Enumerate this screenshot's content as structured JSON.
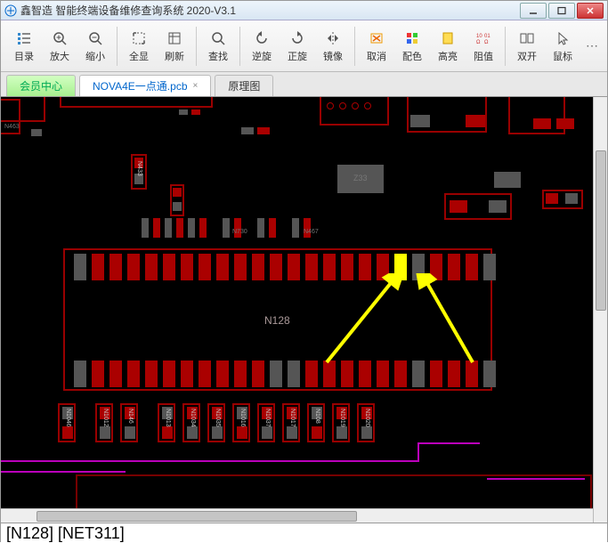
{
  "window": {
    "title": "鑫智造 智能终端设备维修查询系统 2020-V3.1"
  },
  "toolbar": {
    "items": [
      {
        "id": "catalog",
        "label": "目录",
        "glyph": "list"
      },
      {
        "id": "zoomin",
        "label": "放大",
        "glyph": "zoom-in"
      },
      {
        "id": "zoomout",
        "label": "缩小",
        "glyph": "zoom-out"
      },
      {
        "id": "fit",
        "label": "全显",
        "glyph": "fit"
      },
      {
        "id": "refresh",
        "label": "刷新",
        "glyph": "refresh"
      },
      {
        "id": "find",
        "label": "查找",
        "glyph": "search"
      },
      {
        "id": "rotccw",
        "label": "逆旋",
        "glyph": "ccw"
      },
      {
        "id": "rotcw",
        "label": "正旋",
        "glyph": "cw"
      },
      {
        "id": "mirror",
        "label": "镜像",
        "glyph": "mirror"
      },
      {
        "id": "cancel",
        "label": "取消",
        "glyph": "cancel"
      },
      {
        "id": "palette",
        "label": "配色",
        "glyph": "palette"
      },
      {
        "id": "highlight",
        "label": "高亮",
        "glyph": "highlight"
      },
      {
        "id": "imped",
        "label": "阻值",
        "glyph": "ohm"
      },
      {
        "id": "dual",
        "label": "双开",
        "glyph": "dual"
      },
      {
        "id": "mouse",
        "label": "鼠标",
        "glyph": "cursor"
      }
    ]
  },
  "tabs": {
    "member": "会员中心",
    "active": "NOVA4E一点通.pcb",
    "other": "原理图"
  },
  "pcb": {
    "chip_ref": "N128",
    "silklabel": "Z33",
    "top_refs": [
      "N463"
    ],
    "mid_refs": [
      "N433",
      "N730",
      "N467"
    ],
    "bottom_refs": [
      "N1046",
      "N1012",
      "N146",
      "N1013",
      "N1034",
      "N1035",
      "N1016",
      "N1037",
      "N1017",
      "N108",
      "N1019",
      "N1020"
    ]
  },
  "status": {
    "text": "[N128] [NET311]"
  }
}
